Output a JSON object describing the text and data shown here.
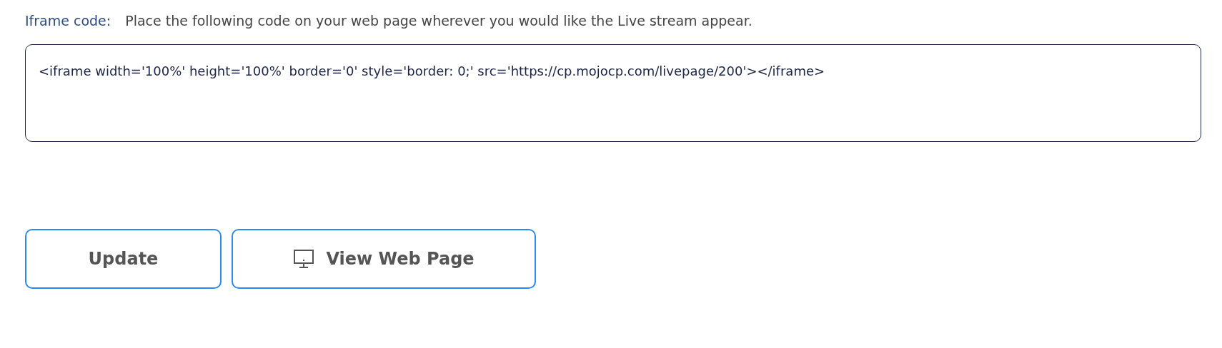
{
  "iframe_code": {
    "label": "Iframe code:",
    "hint": "Place the following code on your web page wherever you would like the Live stream appear.",
    "value": "<iframe width='100%' height='100%' border='0' style='border: 0;' src='https://cp.mojocp.com/livepage/200'></iframe>"
  },
  "buttons": [
    {
      "label": "Update",
      "kind": "plain"
    },
    {
      "label": "View Web Page",
      "kind": "monitor"
    }
  ]
}
